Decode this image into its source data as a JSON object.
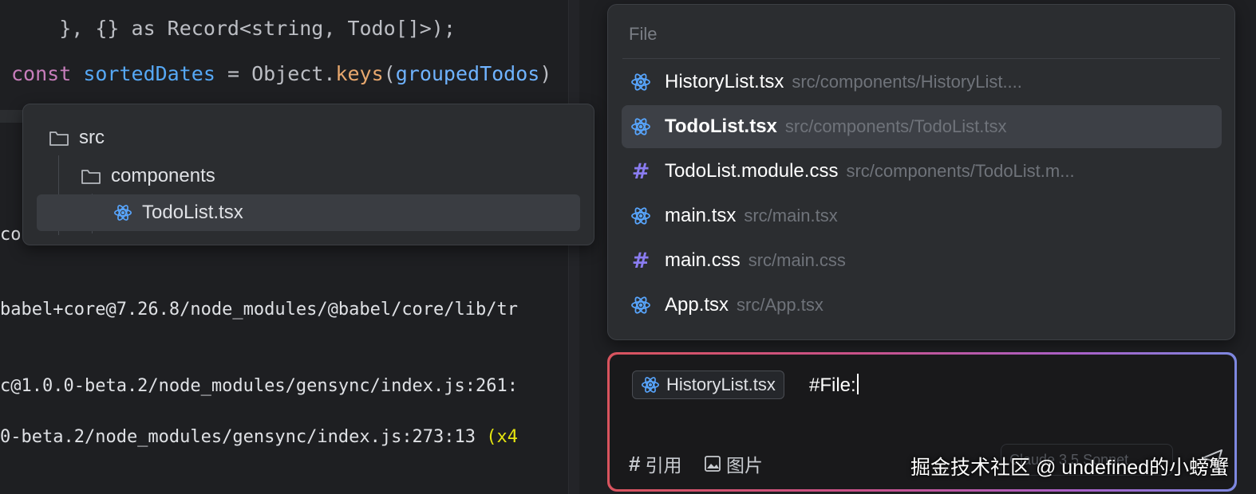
{
  "editor": {
    "code_line_1": "}, {} as Record<string, Todo[]>);",
    "code_line_2_kw": "const",
    "code_line_2_var": "sortedDates",
    "code_line_2_eq": " = ",
    "code_line_2_obj": "Object",
    "code_line_2_dot": ".",
    "code_line_2_method": "keys",
    "code_line_2_paren_open": "(",
    "code_line_2_arg": "groupedTodos",
    "code_line_2_paren_close": ")",
    "terminal_lines": [
      "co",
      "babel+core@7.26.8/node_modules/@babel/core/lib/tr",
      "c@1.0.0-beta.2/node_modules/gensync/index.js:261:",
      "0-beta.2/node_modules/gensync/index.js:273:13"
    ],
    "terminal_repeat": "(x4"
  },
  "tree": {
    "items": [
      {
        "label": "src",
        "icon": "folder-icon"
      },
      {
        "label": "components",
        "icon": "folder-icon"
      },
      {
        "label": "TodoList.tsx",
        "icon": "react-icon"
      }
    ]
  },
  "file_picker": {
    "header": "File",
    "items": [
      {
        "name": "HistoryList.tsx",
        "path": "src/components/HistoryList....",
        "icon": "react-icon"
      },
      {
        "name": "TodoList.tsx",
        "path": "src/components/TodoList.tsx",
        "icon": "react-icon"
      },
      {
        "name": "TodoList.module.css",
        "path": "src/components/TodoList.m...",
        "icon": "hash-icon"
      },
      {
        "name": "main.tsx",
        "path": "src/main.tsx",
        "icon": "react-icon"
      },
      {
        "name": "main.css",
        "path": "src/main.css",
        "icon": "hash-icon"
      },
      {
        "name": "App.tsx",
        "path": "src/App.tsx",
        "icon": "react-icon"
      }
    ],
    "selected_index": 1
  },
  "chat_input": {
    "chip_label": "HistoryList.tsx",
    "typed_text": "#File:",
    "tool_reference": "引用",
    "tool_image": "图片",
    "model_label": "Claude 3.5 Sonnet"
  },
  "watermark": "掘金技术社区 @ undefined的小螃蟹",
  "colors": {
    "react_blue": "#58a6ff",
    "css_purple": "#8a7cf0",
    "gradient": [
      "#d9545e",
      "#c9528a",
      "#a961c9",
      "#7d88e0"
    ]
  }
}
